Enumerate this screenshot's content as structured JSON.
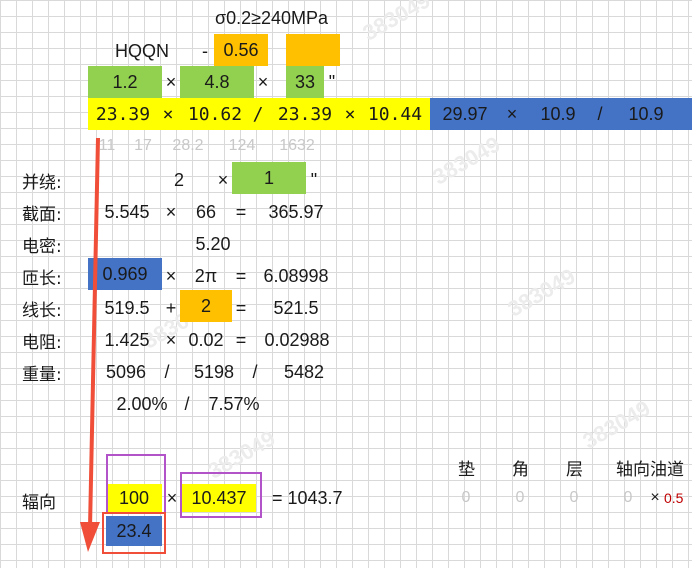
{
  "colors": {
    "yellow": "#ffff00",
    "orange": "#ffc000",
    "green": "#92d050",
    "blue": "#4472c4",
    "purple": "#b253c9",
    "red": "#f04e38",
    "watermark": "#ececec"
  },
  "header": {
    "sigma": "σ0.2≥240MPa",
    "model": "HQQN",
    "dash": "-",
    "ratio": "0.56"
  },
  "row2": {
    "a": "1.2",
    "op1": "×",
    "b": "4.8",
    "op2": "×",
    "c": "33",
    "quote": "\""
  },
  "row3": {
    "v1": "23.39",
    "op1": "×",
    "v2": "10.62",
    "slash": "/",
    "v3": "23.39",
    "op2": "×",
    "v4": "10.44",
    "b1": "29.97",
    "bop": "×",
    "b2": "10.9",
    "bslash": "/",
    "b3": "10.9"
  },
  "faint_row": [
    "11",
    "17",
    "28.2",
    "124",
    "1632"
  ],
  "labels": {
    "parallel": "并绕:",
    "section": "截面:",
    "density": "电密:",
    "turn_len": "匝长:",
    "wire_len": "线长:",
    "resistance": "电阻:",
    "weight": "重量:",
    "radial": "辐向"
  },
  "parallel": {
    "a": "2",
    "op": "×",
    "b": "1",
    "quote": "\""
  },
  "section": {
    "a": "5.545",
    "op": "×",
    "b": "66",
    "eq": "=",
    "result": "365.97"
  },
  "density": {
    "value": "5.20"
  },
  "turn_len": {
    "a": "0.969",
    "op": "×",
    "b": "2π",
    "eq": "=",
    "result": "6.08998"
  },
  "wire_len": {
    "a": "519.5",
    "op": "+",
    "b": "2",
    "eq": "=",
    "result": "521.5"
  },
  "resistance": {
    "a": "1.425",
    "op": "×",
    "b": "0.02",
    "eq": "=",
    "result": "0.02988"
  },
  "weight": {
    "a": "5096",
    "s1": "/",
    "b": "5198",
    "s2": "/",
    "c": "5482",
    "p1": "2.00%",
    "ps": "/",
    "p2": "7.57%"
  },
  "radial": {
    "a": "100",
    "op": "×",
    "b": "10.437",
    "eq_result": "= 1043.7",
    "below": "23.4"
  },
  "right_headers": {
    "pad": "垫",
    "angle": "角",
    "layer": "层",
    "axial_oil": "轴向油道"
  },
  "right_values": {
    "pad": "0",
    "angle": "0",
    "layer": "0",
    "axial": "0",
    "op": "×",
    "tail": "0.5"
  },
  "watermark": "383049"
}
